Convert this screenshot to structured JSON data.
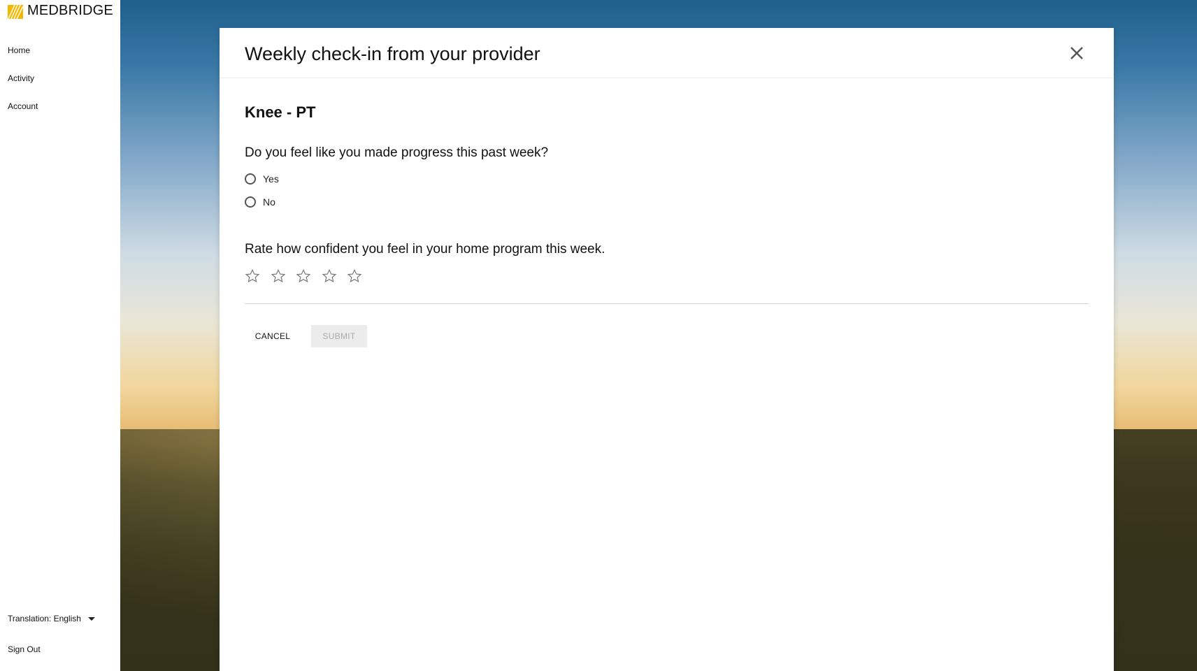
{
  "brand": {
    "name": "MEDBRIDGE",
    "logo_color": "#f5b800"
  },
  "sidebar": {
    "items": [
      {
        "label": "Home"
      },
      {
        "label": "Activity"
      },
      {
        "label": "Account"
      }
    ],
    "translation_label": "Translation: English",
    "sign_out": "Sign Out"
  },
  "modal": {
    "title": "Weekly check-in from your provider",
    "section": "Knee - PT",
    "question_progress": "Do you feel like you made progress this past week?",
    "options": [
      {
        "label": "Yes",
        "selected": false
      },
      {
        "label": "No",
        "selected": false
      }
    ],
    "question_confidence": "Rate how confident you feel in your home program this week.",
    "rating": {
      "value": 0,
      "max": 5
    },
    "cancel_label": "CANCEL",
    "submit_label": "SUBMIT",
    "submit_enabled": false
  },
  "icons": {
    "close": "close-icon",
    "star": "star-outline-icon",
    "caret": "caret-down-icon"
  }
}
